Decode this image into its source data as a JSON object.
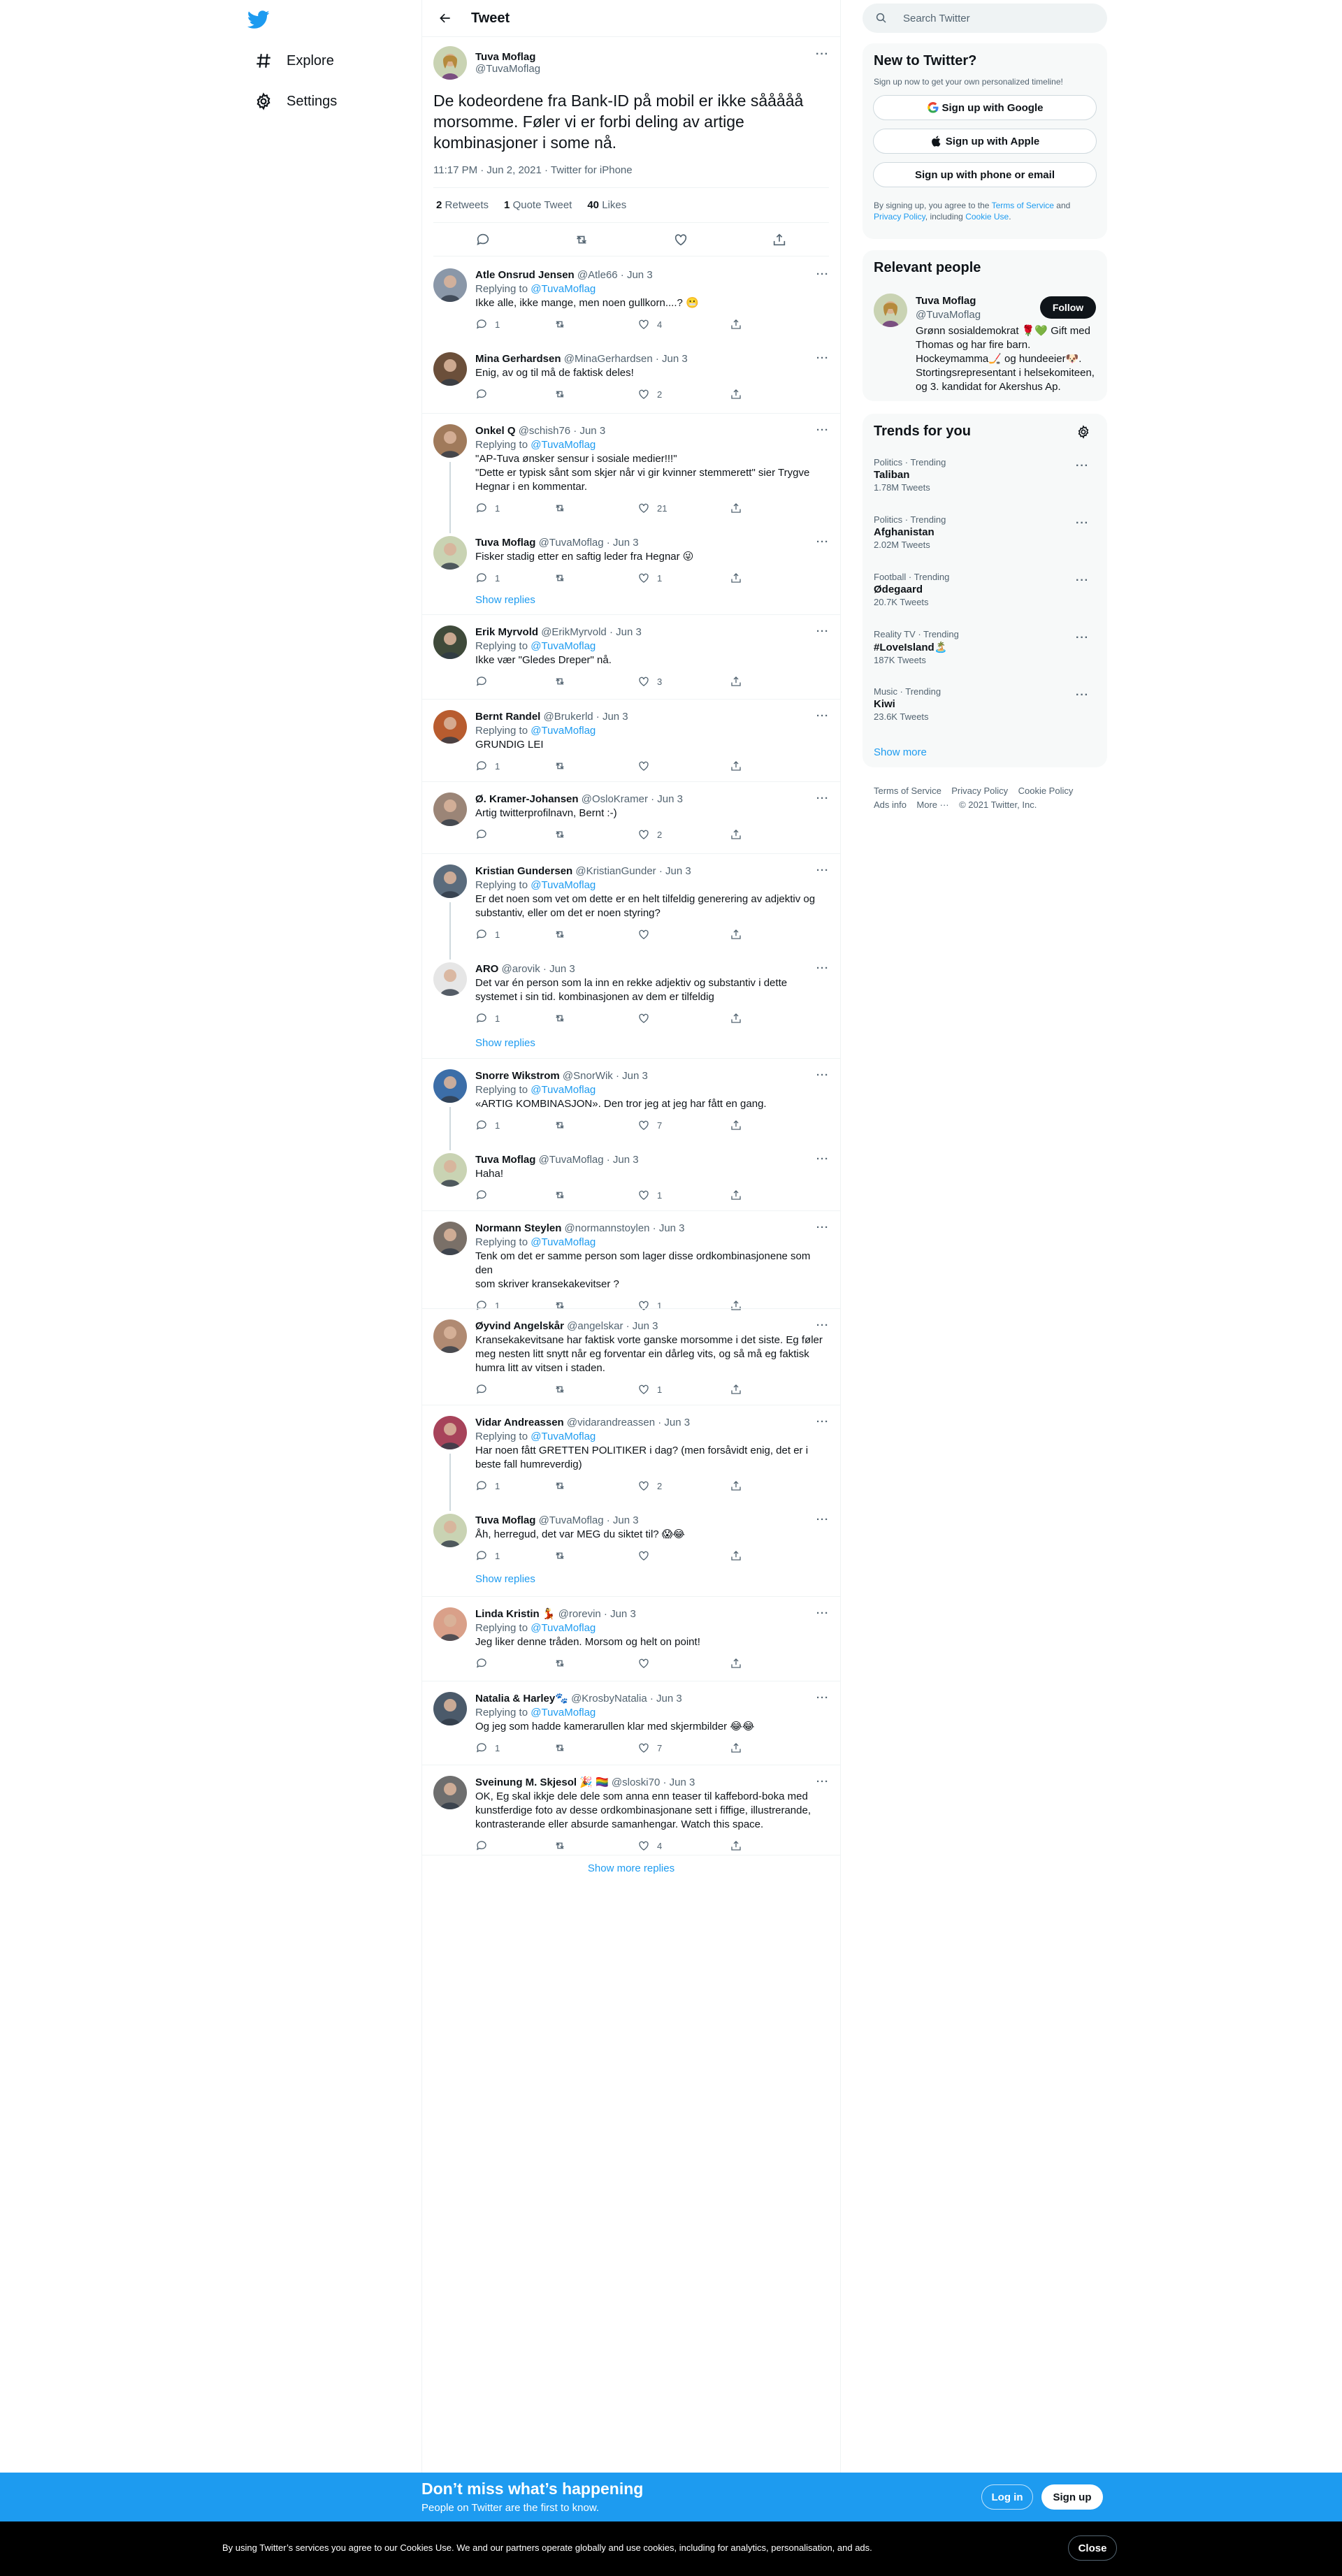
{
  "nav": {
    "explore": "Explore",
    "settings": "Settings"
  },
  "header": {
    "title": "Tweet"
  },
  "focal": {
    "name": "Tuva Moflag",
    "handle": "@TuvaMoflag",
    "text": "De kodeordene fra Bank-ID på mobil er ikke sååååå morsomme. Føler vi er forbi deling av artige kombinasjoner i some nå.",
    "meta": "11:17 PM · Jun 2, 2021 · Twitter for iPhone",
    "retweets": "2",
    "retweets_label": "Retweets",
    "quotes": "1",
    "quotes_label": "Quote Tweet",
    "likes": "40",
    "likes_label": "Likes"
  },
  "replies": [
    {
      "name": "Atle Onsrud Jensen",
      "meta": "@Atle66 · Jun 3",
      "replying": "Replying to",
      "to": "@TuvaMoflag",
      "lines": [
        "Ikke alle, ikke mange, men noen gullkorn....? 😬"
      ],
      "reply_count": "1",
      "rt_count": "",
      "like_count": "4"
    },
    {
      "name": "Mina Gerhardsen",
      "meta": "@MinaGerhardsen · Jun 3",
      "replying": "",
      "to": "",
      "lines": [
        "Enig, av og til må de faktisk deles!"
      ],
      "reply_count": "",
      "rt_count": "",
      "like_count": "2"
    },
    {
      "name": "Onkel Q",
      "meta": "@schish76 · Jun 3",
      "replying": "Replying to",
      "to": "@TuvaMoflag",
      "lines": [
        "\"AP-Tuva ønsker sensur i sosiale medier!!!\"",
        "\"Dette er typisk sånt som skjer når vi gir kvinner stemmerett\" sier Trygve",
        "Hegnar i en kommentar."
      ],
      "reply_count": "1",
      "rt_count": "",
      "like_count": "21"
    },
    {
      "name": "Tuva Moflag",
      "meta": "@TuvaMoflag · Jun 3",
      "replying": "",
      "to": "",
      "lines": [
        "Fisker stadig etter en saftig leder fra Hegnar 😜"
      ],
      "reply_count": "1",
      "rt_count": "",
      "like_count": "1"
    },
    {
      "name": "Erik Myrvold",
      "meta": "@ErikMyrvold · Jun 3",
      "replying": "Replying to",
      "to": "@TuvaMoflag",
      "lines": [
        "Ikke vær \"Gledes Dreper\" nå."
      ],
      "reply_count": "",
      "rt_count": "",
      "like_count": "3"
    },
    {
      "name": "Bernt Randel",
      "meta": "@Brukerld · Jun 3",
      "replying": "Replying to",
      "to": "@TuvaMoflag",
      "lines": [
        "GRUNDIG LEI"
      ],
      "reply_count": "1",
      "rt_count": "",
      "like_count": ""
    },
    {
      "name": "Ø. Kramer-Johansen",
      "meta": "@OsloKramer · Jun 3",
      "replying": "",
      "to": "",
      "lines": [
        "Artig twitterprofilnavn, Bernt :-)"
      ],
      "reply_count": "",
      "rt_count": "",
      "like_count": "2"
    },
    {
      "name": "Kristian Gundersen",
      "meta": "@KristianGunder · Jun 3",
      "replying": "Replying to",
      "to": "@TuvaMoflag",
      "lines": [
        "Er det noen som vet om dette er en helt tilfeldig generering av adjektiv og",
        "substantiv, eller om det er noen styring?"
      ],
      "reply_count": "1",
      "rt_count": "",
      "like_count": ""
    },
    {
      "name": "ARO",
      "meta": "@arovik · Jun 3",
      "replying": "",
      "to": "",
      "lines": [
        "Det var én person som la inn en rekke adjektiv og substantiv i dette",
        "systemet i sin tid. kombinasjonen av dem er tilfeldig"
      ],
      "reply_count": "1",
      "rt_count": "",
      "like_count": ""
    },
    {
      "name": "Snorre Wikstrom",
      "meta": "@SnorWik · Jun 3",
      "replying": "Replying to",
      "to": "@TuvaMoflag",
      "lines": [
        "«ARTIG KOMBINASJON». Den tror jeg at jeg har fått en gang."
      ],
      "reply_count": "1",
      "rt_count": "",
      "like_count": "7"
    },
    {
      "name": "Tuva Moflag",
      "meta": "@TuvaMoflag · Jun 3",
      "replying": "",
      "to": "",
      "lines": [
        "Haha!"
      ],
      "reply_count": "",
      "rt_count": "",
      "like_count": "1"
    },
    {
      "name": "Normann Steylen",
      "meta": "@normannstoylen · Jun 3",
      "replying": "Replying to",
      "to": "@TuvaMoflag",
      "lines": [
        "Tenk om det er samme person som lager disse ordkombinasjonene som den",
        "som skriver kransekakevitser ?"
      ],
      "reply_count": "1",
      "rt_count": "",
      "like_count": "1"
    },
    {
      "name": "Øyvind Angelskår",
      "meta": "@angelskar · Jun 3",
      "replying": "",
      "to": "",
      "lines": [
        "Kransekakevitsane har faktisk vorte ganske morsomme i det siste. Eg føler",
        "meg nesten litt snytt når eg forventar ein dårleg vits, og så må eg faktisk",
        "humra litt av vitsen i staden."
      ],
      "reply_count": "",
      "rt_count": "",
      "like_count": "1"
    },
    {
      "name": "Vidar Andreassen",
      "meta": "@vidarandreassen · Jun 3",
      "replying": "Replying to",
      "to": "@TuvaMoflag",
      "lines": [
        "Har noen fått GRETTEN POLITIKER i dag? (men forsåvidt enig, det er i",
        "beste fall humreverdig)"
      ],
      "reply_count": "1",
      "rt_count": "",
      "like_count": "2"
    },
    {
      "name": "Tuva Moflag",
      "meta": "@TuvaMoflag · Jun 3",
      "replying": "",
      "to": "",
      "lines": [
        "Åh, herregud, det var MEG du siktet til? 😱😂"
      ],
      "reply_count": "1",
      "rt_count": "",
      "like_count": ""
    },
    {
      "name": "Linda Kristin 💃",
      "meta": "@rorevin · Jun 3",
      "replying": "Replying to",
      "to": "@TuvaMoflag",
      "lines": [
        "Jeg liker denne tråden. Morsom og helt on point!"
      ],
      "reply_count": "",
      "rt_count": "",
      "like_count": ""
    },
    {
      "name": "Natalia & Harley🐾",
      "meta": "@KrosbyNatalia · Jun 3",
      "replying": "Replying to",
      "to": "@TuvaMoflag",
      "lines": [
        "Og jeg som hadde kamerarullen klar med skjermbilder 😂😂"
      ],
      "reply_count": "1",
      "rt_count": "",
      "like_count": "7"
    },
    {
      "name": "Sveinung M. Skjesol 🎉 🏳️‍🌈",
      "meta": "@sloski70 · Jun 3",
      "replying": "",
      "to": "",
      "lines": [
        "OK, Eg skal ikkje dele dele som anna enn teaser til kaffebord-boka med",
        "kunstferdige foto av desse ordkombinasjonane sett i fiffige, illustrerande,",
        "kontrasterande eller absurde samanhengar. Watch this space."
      ],
      "reply_count": "",
      "rt_count": "",
      "like_count": "4"
    }
  ],
  "show_replies": "Show replies",
  "show_more_replies": "Show more replies",
  "right": {
    "search_placeholder": "Search Twitter",
    "new_title": "New to Twitter?",
    "new_sub": "Sign up now to get your own personalized timeline!",
    "google": "Sign up with Google",
    "apple": "Sign up with Apple",
    "phone": "Sign up with phone or email",
    "terms_pre": "By signing up, you agree to the",
    "terms": "Terms of Service",
    "and": "and",
    "privacy": "Privacy Policy",
    "including": ", including",
    "cookie": "Cookie Use",
    "relevant_title": "Relevant people",
    "rp_name": "Tuva Moflag",
    "rp_handle": "@TuvaMoflag",
    "rp_follow": "Follow",
    "rp_bio": [
      "Grønn sosialdemokrat 🌹💚 Gift med",
      "Thomas og har fire barn.",
      "Hockeymamma🏒 og hundeeier🐶.",
      "Stortingsrepresentant i helsekomiteen,",
      "og 3. kandidat for Akershus Ap."
    ],
    "trends_title": "Trends for you",
    "trends": [
      {
        "cat": "Politics · Trending",
        "title": "Taliban",
        "count": "1.78M Tweets"
      },
      {
        "cat": "Politics · Trending",
        "title": "Afghanistan",
        "count": "2.02M Tweets"
      },
      {
        "cat": "Football · Trending",
        "title": "Ødegaard",
        "count": "20.7K Tweets"
      },
      {
        "cat": "Reality TV · Trending",
        "title": "#LoveIsland🏝️",
        "count": "187K Tweets"
      },
      {
        "cat": "Music · Trending",
        "title": "Kiwi",
        "count": "23.6K Tweets"
      }
    ],
    "show_more": "Show more",
    "footer1": "Terms of Service    Privacy Policy    Cookie Policy",
    "footer2": "Ads info    More ···    © 2021 Twitter, Inc."
  },
  "banner": {
    "title": "Don’t miss what’s happening",
    "sub": "People on Twitter are the first to know.",
    "login": "Log in",
    "signup": "Sign up"
  },
  "cookies": {
    "text": "By using Twitter’s services you agree to our Cookies Use. We and our partners operate globally and use cookies, including for analytics, personalisation, and ads.",
    "close": "Close"
  },
  "colors": {
    "accent": "#1d9bf0",
    "text": "#0f1419",
    "muted": "#536471",
    "panel": "#f7f9f9"
  }
}
